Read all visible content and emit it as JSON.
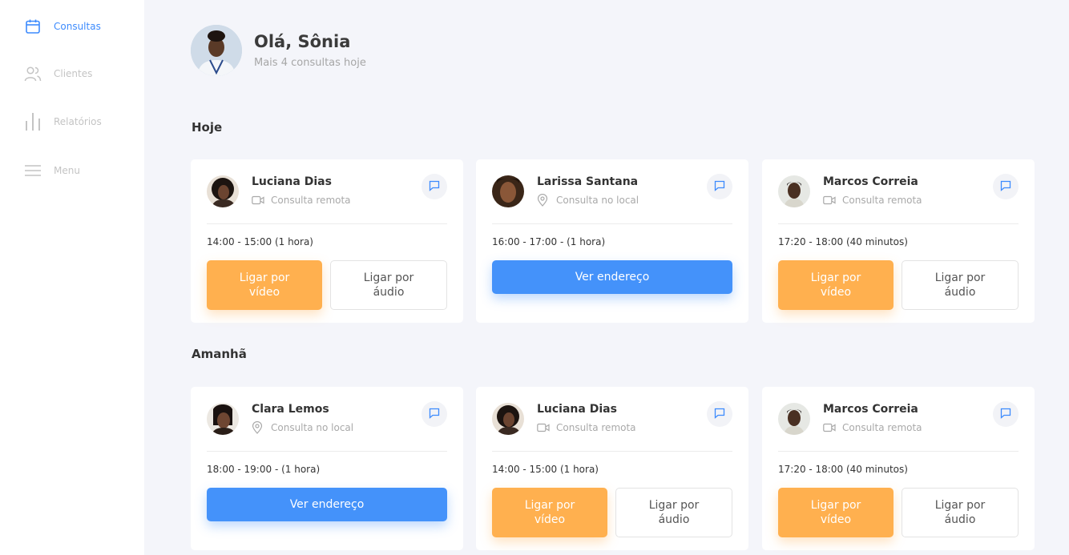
{
  "sidebar": {
    "items": [
      {
        "label": "Consultas",
        "icon": "calendar-icon",
        "active": true
      },
      {
        "label": "Clientes",
        "icon": "users-icon",
        "active": false
      },
      {
        "label": "Relatórios",
        "icon": "bar-chart-icon",
        "active": false
      },
      {
        "label": "Menu",
        "icon": "menu-icon",
        "active": false
      }
    ]
  },
  "header": {
    "greeting": "Olá, Sônia",
    "subtitle": "Mais 4 consultas hoje"
  },
  "sections": [
    {
      "title": "Hoje",
      "cards": [
        {
          "name": "Luciana Dias",
          "type": "Consulta remota",
          "type_icon": "video-icon",
          "time": "14:00 - 15:00 (1 hora)",
          "primary": "Ligar por vídeo",
          "secondary": "Ligar por áudio"
        },
        {
          "name": "Larissa Santana",
          "type": "Consulta no local",
          "type_icon": "location-pin-icon",
          "time": "16:00 - 17:00 - (1 hora)",
          "primary": "Ver endereço"
        },
        {
          "name": "Marcos Correia",
          "type": "Consulta remota",
          "type_icon": "video-icon",
          "time": "17:20 - 18:00 (40 minutos)",
          "primary": "Ligar por vídeo",
          "secondary": "Ligar por áudio"
        }
      ]
    },
    {
      "title": "Amanhã",
      "cards": [
        {
          "name": "Clara Lemos",
          "type": "Consulta no local",
          "type_icon": "location-pin-icon",
          "time": "18:00 - 19:00 - (1 hora)",
          "primary": "Ver endereço"
        },
        {
          "name": "Luciana Dias",
          "type": "Consulta remota",
          "type_icon": "video-icon",
          "time": "14:00 - 15:00 (1 hora)",
          "primary": "Ligar por vídeo",
          "secondary": "Ligar por áudio"
        },
        {
          "name": "Marcos Correia",
          "type": "Consulta remota",
          "type_icon": "video-icon",
          "time": "17:20 - 18:00 (40 minutos)",
          "primary": "Ligar por vídeo",
          "secondary": "Ligar por áudio"
        }
      ]
    }
  ],
  "colors": {
    "accent": "#3d8bfd",
    "video_button": "#ffb04f",
    "address_button": "#4492fa",
    "background": "#f4f5fa"
  }
}
